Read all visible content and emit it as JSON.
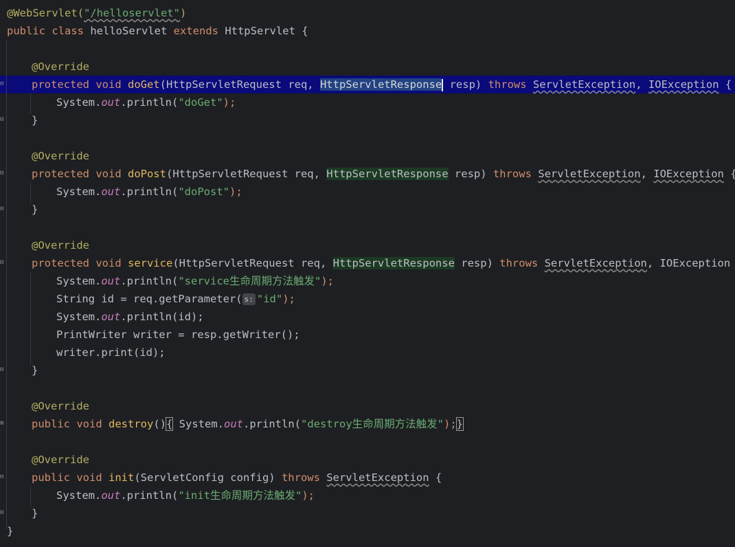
{
  "code": {
    "l1_ann": "@WebServlet(",
    "l1_str": "\"/helloservlet\"",
    "l1_end": ")",
    "l2_kw": "public class ",
    "l2_name": "helloServlet ",
    "l2_ext": "extends ",
    "l2_rest": "HttpServlet {",
    "override": "@Override",
    "get_kw": "protected void ",
    "get_name": "doGet",
    "get_p1": "(HttpServletRequest req, ",
    "get_sel": "HttpServletResponse",
    "get_p2": " resp) ",
    "get_throws": "throws ",
    "get_ex1": "ServletException",
    "get_comma": ", ",
    "get_ex2": "IOException",
    "get_brace": " {",
    "get_body_a": "System.",
    "get_body_out": "out",
    "get_body_b": ".println(",
    "get_body_str": "\"doGet\"",
    "get_body_c": ");",
    "close": "}",
    "post_kw": "protected void ",
    "post_name": "doPost",
    "post_p1": "(HttpServletRequest req, ",
    "post_hl": "HttpServletResponse",
    "post_p2": " resp) ",
    "post_throws": "throws ",
    "post_ex1": "ServletException",
    "post_comma": ", ",
    "post_ex2": "IOException",
    "post_brace": " {",
    "post_body_str": "\"doPost\"",
    "svc_kw": "protected void ",
    "svc_name": "service",
    "svc_p1": "(HttpServletRequest req, ",
    "svc_hl": "HttpServletResponse",
    "svc_p2": " resp) ",
    "svc_throws": "throws ",
    "svc_ex1": "ServletException",
    "svc_rest": ", IOException {",
    "svc_b1_str": "\"service生命周期方法触发\"",
    "svc_b2_a": "String id = req.getParameter(",
    "svc_b2_hint": "s:",
    "svc_b2_str": "\"id\"",
    "svc_b2_c": ");",
    "svc_b3_c": ".println(id);",
    "svc_b4": "PrintWriter writer = resp.getWriter();",
    "svc_b5": "writer.print(id);",
    "des_kw": "public void ",
    "des_name": "destroy",
    "des_paren": "()",
    "des_ob": "{",
    "des_sp": " ",
    "des_sys": "System.",
    "des_str": "\"destroy生命周期方法触发\"",
    "des_semi": ");",
    "des_cb": "}",
    "init_kw": "public void ",
    "init_name": "init",
    "init_p1": "(ServletConfig config) ",
    "init_throws": "throws ",
    "init_ex": "ServletException",
    "init_brace": " {",
    "init_body_str": "\"init生命周期方法触发\"",
    "final_close": "}"
  }
}
